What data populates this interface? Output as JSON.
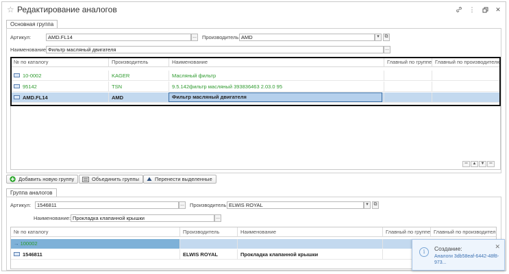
{
  "window": {
    "title": "Редактирование аналогов",
    "icons": [
      "link-icon",
      "more-icon",
      "restore-icon",
      "close-icon"
    ]
  },
  "main_group": {
    "tab_label": "Основная группа",
    "article_label": "Артикул:",
    "article_value": "AMD.FL14",
    "manufacturer_label": "Производитель:",
    "manufacturer_value": "AMD",
    "name_label": "Наименование:",
    "name_value": "Фильтр масляный двигателя",
    "columns": [
      "№ по каталогу",
      "Производитель",
      "Наименование",
      "Главный по группе",
      "Главный по производителю"
    ],
    "rows": [
      {
        "catalog": "10-0002",
        "manufacturer": "KAGER",
        "name": "Масляный фильтр",
        "style": "green"
      },
      {
        "catalog": "95142",
        "manufacturer": "TSN",
        "name": "9.5.142фильтр масляный 393836463 2.03.0 95",
        "style": "green"
      },
      {
        "catalog": "AMD.FL14",
        "manufacturer": "AMD",
        "name": "Фильтр масляный двигателя",
        "style": "selected"
      }
    ]
  },
  "toolbar": {
    "add_group_label": "Добавить новую группу",
    "merge_groups_label": "Объединить группы",
    "move_selected_label": "Перенести выделенные"
  },
  "analog_group": {
    "tab_label": "Группа аналогов",
    "article_label": "Артикул:",
    "article_value": "1546811",
    "manufacturer_label": "Производитель:",
    "manufacturer_value": "ELWIS ROYAL",
    "name_label": "Наименование:",
    "name_value": "Прокладка клапанной крышки",
    "columns": [
      "№ по каталогу",
      "Производитель",
      "Наименование",
      "Главный по группе",
      "Главный по производителю"
    ],
    "rows": [
      {
        "catalog": "100002",
        "manufacturer": "",
        "name": "",
        "style": "group"
      },
      {
        "catalog": "1546811",
        "manufacturer": "ELWIS ROYAL",
        "name": "Прокладка клапанной крышки",
        "style": "bold"
      }
    ]
  },
  "notification": {
    "title": "Создание:",
    "text": "Аналоги 3db58eaf-6442-48f8-973..."
  },
  "colors": {
    "green_text": "#2e9a2e",
    "selected_row": "#c3d9ef",
    "group_row": "#7eb1d8",
    "accent_green": "#2aa52a"
  }
}
